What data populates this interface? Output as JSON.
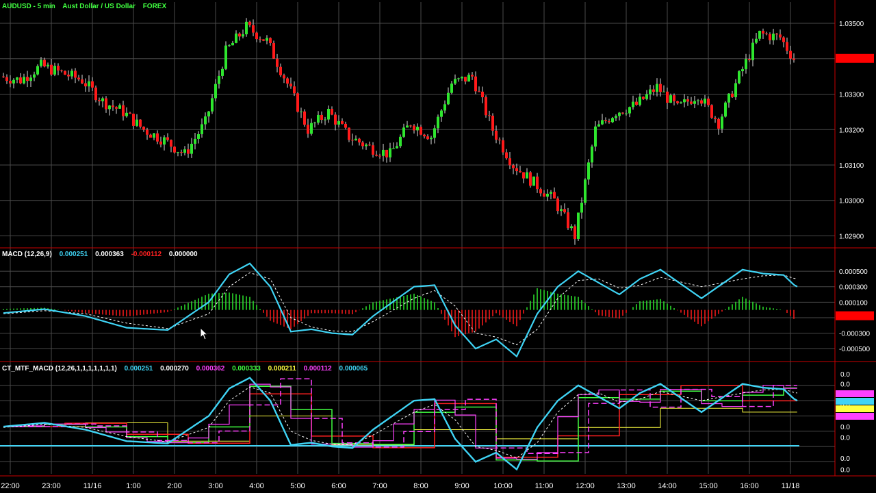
{
  "title": {
    "symbol": "AUDUSD - 5 min",
    "description": "Aust Dollar / US Dollar",
    "exchange": "FOREX"
  },
  "macd_header": {
    "label": "MACD (12,26,9)",
    "values": [
      {
        "text": "0.000251",
        "color": "#3fd4f5"
      },
      {
        "text": "0.000363",
        "color": "#ffffff"
      },
      {
        "text": "-0.000112",
        "color": "#ff2020"
      },
      {
        "text": "0.000000",
        "color": "#ffffff"
      }
    ]
  },
  "mtf_header": {
    "label": "CT_MTF_MACD (12,26,1,1,1,1,1,1,1)",
    "values": [
      {
        "text": "0.000251",
        "color": "#3fd4f5"
      },
      {
        "text": "0.000270",
        "color": "#ffffff"
      },
      {
        "text": "0.000362",
        "color": "#ff40ff"
      },
      {
        "text": "0.000333",
        "color": "#40ff40"
      },
      {
        "text": "0.000211",
        "color": "#ffff40"
      },
      {
        "text": "0.000112",
        "color": "#ff40ff"
      },
      {
        "text": "0.000065",
        "color": "#3fd4f5"
      }
    ]
  },
  "price_axis": {
    "labels": [
      "1.03500",
      "1.03400",
      "1.03300",
      "1.03200",
      "1.03100",
      "1.03000",
      "1.02900"
    ]
  },
  "macd_axis": {
    "labels": [
      "0.000500",
      "0.000300",
      "0.000100",
      "-0.000300",
      "-0.000500"
    ]
  },
  "mtf_axis": {
    "labels": [
      "0.0",
      "0.0",
      "0.0",
      "0.0",
      "0.0",
      "0.0",
      "0.0",
      "0.0",
      "0.0"
    ]
  },
  "time_axis": {
    "labels": [
      "22:00",
      "23:00",
      "11/16",
      "1:00",
      "2:00",
      "3:00",
      "4:00",
      "5:00",
      "6:00",
      "7:00",
      "8:00",
      "9:00",
      "10:00",
      "11:00",
      "12:00",
      "13:00",
      "14:00",
      "15:00",
      "16:00",
      "11/18"
    ]
  },
  "colors": {
    "up": "#2ee62e",
    "down": "#ff1a1a",
    "macd_line": "#3fd4f5",
    "signal": "#ffffff",
    "grid": "#4a4a4a",
    "separator": "#cc0000",
    "axis_text": "#ffffff",
    "title_text": "#40ff40"
  },
  "chart_data": [
    {
      "type": "candlestick",
      "title": "AUDUSD - 5 min  Aust Dollar / US Dollar  FOREX",
      "ylim": [
        1.0287,
        1.0356
      ],
      "close_path_hours": [
        0,
        0.5,
        1,
        1.5,
        2,
        2.5,
        3,
        3.5,
        4,
        4.5,
        5,
        5.5,
        6,
        6.5,
        7,
        7.5,
        8,
        8.5,
        9,
        9.5,
        10,
        10.5,
        11,
        11.5,
        12,
        12.5,
        13,
        13.5,
        14,
        14.5,
        15,
        15.5,
        16,
        16.5,
        17,
        17.5,
        18,
        18.5,
        19,
        19.33
      ],
      "close_path_values": [
        1.0335,
        1.0334,
        1.0338,
        1.0336,
        1.0334,
        1.0328,
        1.0325,
        1.032,
        1.0317,
        1.0313,
        1.0322,
        1.0342,
        1.0349,
        1.0345,
        1.0333,
        1.032,
        1.0325,
        1.0318,
        1.0315,
        1.0313,
        1.0322,
        1.0318,
        1.0333,
        1.0335,
        1.032,
        1.031,
        1.0305,
        1.03,
        1.029,
        1.032,
        1.0325,
        1.0327,
        1.0332,
        1.0326,
        1.033,
        1.0322,
        1.0335,
        1.0347,
        1.0346,
        1.034
      ],
      "last_price_marker": "1.03400"
    },
    {
      "type": "line",
      "title": "MACD (12,26,9)",
      "ylim": [
        -0.00064,
        0.00066
      ],
      "series": [
        {
          "name": "MACD",
          "x": [
            0,
            1,
            2,
            3,
            4,
            5,
            5.5,
            6,
            6.5,
            7,
            7.5,
            8,
            8.5,
            9,
            10,
            10.5,
            11,
            11.5,
            12,
            12.5,
            13,
            13.5,
            14,
            14.5,
            15,
            15.5,
            16,
            17,
            18,
            18.5,
            19,
            19.3
          ],
          "values": [
            -4e-05,
            1e-05,
            -8e-05,
            -0.00023,
            -0.00026,
            0.0001,
            0.00046,
            0.0006,
            0.0003,
            -0.00028,
            -0.00025,
            -0.0003,
            -0.00032,
            -8e-05,
            0.0003,
            0.00032,
            -0.0002,
            -0.0005,
            -0.00038,
            -0.0006,
            -5e-05,
            0.0003,
            0.0005,
            0.00035,
            0.0002,
            0.0004,
            0.00052,
            0.00015,
            0.00052,
            0.00047,
            0.00045,
            0.0003
          ]
        },
        {
          "name": "Signal",
          "x": [
            0,
            1,
            2,
            3,
            4,
            5,
            5.5,
            6,
            6.5,
            7,
            7.5,
            8,
            8.5,
            9,
            10,
            10.5,
            11,
            11.5,
            12,
            12.5,
            13,
            13.5,
            14,
            14.5,
            15,
            15.5,
            16,
            17,
            18,
            18.5,
            19,
            19.3
          ],
          "values": [
            -5e-05,
            -1e-05,
            -5e-05,
            -0.00017,
            -0.00024,
            -5e-05,
            0.0003,
            0.00048,
            0.0004,
            -0.0001,
            -0.00022,
            -0.00027,
            -0.00028,
            -0.00015,
            0.00015,
            0.00025,
            5e-05,
            -0.0003,
            -0.00035,
            -0.00045,
            -0.00025,
            0.00015,
            0.00038,
            0.0004,
            0.00028,
            0.00032,
            0.00042,
            0.0003,
            0.0004,
            0.00044,
            0.00045,
            0.0004
          ]
        }
      ]
    },
    {
      "type": "line",
      "title": "CT_MTF_MACD (12,26,1,1,1,1,1,1,1)",
      "ylim": [
        -0.00064,
        0.00066
      ],
      "series": [
        {
          "name": "MTF 1",
          "x": [
            0,
            1,
            2,
            3,
            4,
            5,
            5.5,
            6,
            6.5,
            7,
            7.5,
            8,
            8.5,
            9,
            10,
            10.5,
            11,
            11.5,
            12,
            12.5,
            13,
            13.5,
            14,
            14.5,
            15,
            15.5,
            16,
            17,
            18,
            18.5,
            19,
            19.3
          ],
          "values": [
            -4e-05,
            1e-05,
            -8e-05,
            -0.00023,
            -0.00026,
            0.0001,
            0.00046,
            0.0006,
            0.0003,
            -0.00028,
            -0.00025,
            -0.0003,
            -0.00032,
            -8e-05,
            0.0003,
            0.00032,
            -0.0002,
            -0.0005,
            -0.00038,
            -0.0006,
            -5e-05,
            0.0003,
            0.0005,
            0.00035,
            0.0002,
            0.0004,
            0.00052,
            0.00015,
            0.00052,
            0.00047,
            0.00045,
            0.0003
          ]
        }
      ]
    }
  ]
}
